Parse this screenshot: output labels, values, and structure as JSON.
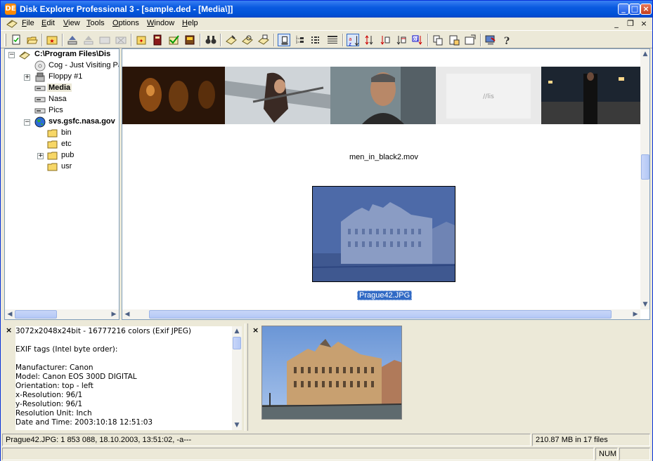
{
  "titlebar": {
    "app_icon": "DE",
    "title": "Disk Explorer Professional 3 - [sample.ded - [Media\\]]",
    "min": "_",
    "max": "□",
    "close": "×"
  },
  "menubar": {
    "items": [
      "File",
      "Edit",
      "View",
      "Tools",
      "Options",
      "Window",
      "Help"
    ],
    "mdi_min": "_",
    "mdi_restore": "❐",
    "mdi_close": "×"
  },
  "toolbar": {
    "icons": [
      "new-document-icon",
      "open-folder-icon",
      "favorite-folder-icon",
      "eject-icon",
      "eject-disabled-icon",
      "tray-disabled-icon",
      "delete-disabled-icon",
      "new-item-icon",
      "catalog-icon",
      "checkmark-icon",
      "database-icon",
      "binoculars-icon",
      "compose-icon",
      "find-icon",
      "print-icon",
      "large-icons-view-icon",
      "tree-view-icon",
      "list-view-icon",
      "details-view-icon",
      "sort-name-icon",
      "sort-size-icon",
      "sort-type-icon",
      "sort-date-icon",
      "sort-attr-icon",
      "copy-icon",
      "properties-icon",
      "settings-icon",
      "export-icon",
      "help-icon"
    ]
  },
  "tree": {
    "root": "C:\\Program Files\\Dis",
    "items": [
      {
        "label": "Cog - Just Visiting Pa",
        "icon": "cd-icon"
      },
      {
        "label": "Floppy #1",
        "icon": "floppy-icon"
      },
      {
        "label": "Media",
        "icon": "drive-icon"
      },
      {
        "label": "Nasa",
        "icon": "drive-icon"
      },
      {
        "label": "Pics",
        "icon": "drive-icon"
      },
      {
        "label": "svs.gsfc.nasa.gov",
        "icon": "globe-icon"
      }
    ],
    "subitems": [
      "bin",
      "etc",
      "pub",
      "usr"
    ]
  },
  "main": {
    "video_file": "men_in_black2.mov",
    "image_file": "Prague42.JPG"
  },
  "info": {
    "lines": [
      "3072x2048x24bit - 16777216 colors  (Exif JPEG)",
      "",
      "EXIF tags (Intel byte order):",
      "",
      "Manufacturer: Canon",
      "Model: Canon EOS 300D DIGITAL",
      "Orientation: top - left",
      "x-Resolution: 96/1",
      "y-Resolution: 96/1",
      "Resolution Unit: Inch",
      "Date and Time: 2003:10:18 12:51:03"
    ],
    "close": "×"
  },
  "preview": {
    "close": "×"
  },
  "statusbar": {
    "file_info": "Prague42.JPG: 1 853 088, 18.10.2003, 13:51:02, -a---",
    "summary": "210.87 MB in 17 files",
    "num": "NUM"
  },
  "colors": {
    "titlebar": "#0054e3",
    "selection": "#316ac5",
    "face": "#ece9d8"
  }
}
